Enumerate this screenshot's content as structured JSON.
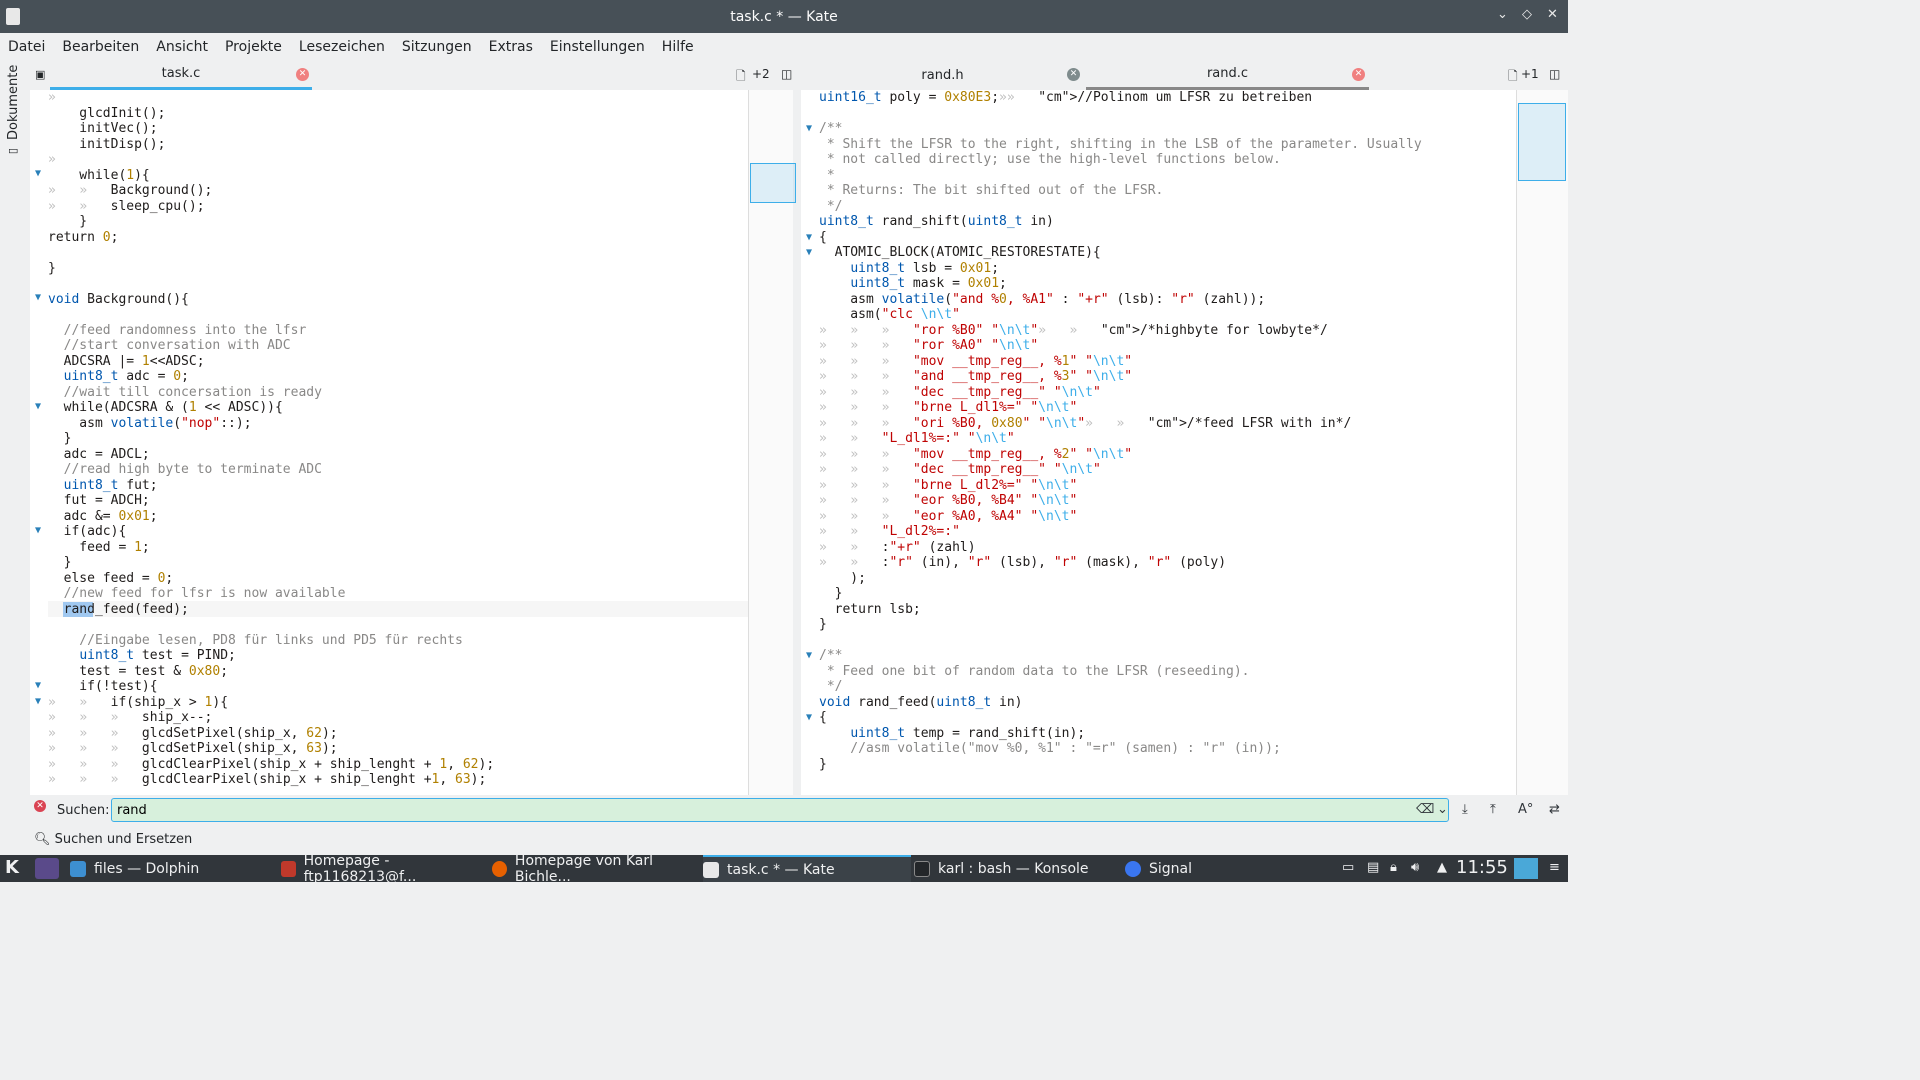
{
  "window": {
    "title": "task.c * — Kate"
  },
  "menu": [
    "Datei",
    "Bearbeiten",
    "Ansicht",
    "Projekte",
    "Lesezeichen",
    "Sitzungen",
    "Extras",
    "Einstellungen",
    "Hilfe"
  ],
  "sidebar": {
    "label": "Dokumente"
  },
  "left_pane": {
    "tab": "task.c",
    "more_tabs": "+2",
    "lines": [
      "»",
      "    glcdInit();",
      "    initVec();",
      "    initDisp();",
      "»",
      "    while(1){",
      "»   »   Background();",
      "»   »   sleep_cpu();",
      "    }",
      "return 0;",
      "",
      "}",
      "",
      "void Background(){",
      "",
      "  //feed randomness into the lfsr",
      "  //start conversation with ADC",
      "  ADCSRA |= 1<<ADSC;",
      "  uint8_t adc = 0;",
      "  //wait till concersation is ready",
      "  while(ADCSRA & (1 << ADSC)){",
      "    asm volatile(\"nop\"::);",
      "  }",
      "  adc = ADCL;",
      "  //read high byte to terminate ADC",
      "  uint8_t fut;",
      "  fut = ADCH;",
      "  adc &= 0x01;",
      "  if(adc){",
      "    feed = 1;",
      "  }",
      "  else feed = 0;",
      "  //new feed for lfsr is now available",
      "  rand_feed(feed);",
      "",
      "    //Eingabe lesen, PD8 für links und PD5 für rechts",
      "    uint8_t test = PIND;",
      "    test = test & 0x80;",
      "    if(!test){",
      "»   »   if(ship_x > 1){",
      "»   »   »   ship_x--;",
      "»   »   »   glcdSetPixel(ship_x, 62);",
      "»   »   »   glcdSetPixel(ship_x, 63);",
      "»   »   »   glcdClearPixel(ship_x + ship_lenght + 1, 62);",
      "»   »   »   glcdClearPixel(ship_x + ship_lenght +1, 63);"
    ]
  },
  "right_pane": {
    "tab1": "rand.h",
    "tab2": "rand.c",
    "more_tabs": "+1",
    "lines": [
      "uint16_t poly = 0x80E3;»»   //Polinom um LFSR zu betreiben",
      "",
      "/**",
      " * Shift the LFSR to the right, shifting in the LSB of the parameter. Usually",
      " * not called directly; use the high-level functions below.",
      " *",
      " * Returns: The bit shifted out of the LFSR.",
      " */",
      "uint8_t rand_shift(uint8_t in)",
      "{",
      "  ATOMIC_BLOCK(ATOMIC_RESTORESTATE){",
      "    uint8_t lsb = 0x01;",
      "    uint8_t mask = 0x01;",
      "    asm volatile(\"and %0, %A1\" : \"+r\" (lsb): \"r\" (zahl));",
      "    asm(\"clc \\n\\t\"",
      "»   »   »   \"ror %B0\" \"\\n\\t\"»   »   /*highbyte for lowbyte*/",
      "»   »   »   \"ror %A0\" \"\\n\\t\"",
      "»   »   »   \"mov __tmp_reg__, %1\" \"\\n\\t\"",
      "»   »   »   \"and __tmp_reg__, %3\" \"\\n\\t\"",
      "»   »   »   \"dec __tmp_reg__\" \"\\n\\t\"",
      "»   »   »   \"brne L_dl1%=\" \"\\n\\t\"",
      "»   »   »   \"ori %B0, 0x80\" \"\\n\\t\"»   »   /*feed LFSR with in*/",
      "»   »   \"L_dl1%=:\" \"\\n\\t\"",
      "»   »   »   \"mov __tmp_reg__, %2\" \"\\n\\t\"",
      "»   »   »   \"dec __tmp_reg__\" \"\\n\\t\"",
      "»   »   »   \"brne L_dl2%=\" \"\\n\\t\"",
      "»   »   »   \"eor %B0, %B4\" \"\\n\\t\"",
      "»   »   »   \"eor %A0, %A4\" \"\\n\\t\"",
      "»   »   \"L_dl2%=:\"",
      "»   »   :\"+r\" (zahl)",
      "»   »   :\"r\" (in), \"r\" (lsb), \"r\" (mask), \"r\" (poly)",
      "    );",
      "  }",
      "  return lsb;",
      "}",
      "",
      "/**",
      " * Feed one bit of random data to the LFSR (reseeding).",
      " */",
      "void rand_feed(uint8_t in)",
      "{",
      "    uint8_t temp = rand_shift(in);",
      "    //asm volatile(\"mov %0, %1\" : \"=r\" (samen) : \"r\" (in));",
      "}"
    ]
  },
  "search": {
    "label": "Suchen:",
    "value": "rand",
    "replace_label": "Suchen und Ersetzen"
  },
  "taskbar": {
    "tasks": [
      "files — Dolphin",
      "Homepage - ftp1168213@f...",
      "Homepage von Karl Bichle...",
      "task.c * — Kate",
      "karl : bash — Konsole",
      "Signal"
    ],
    "clock": "11:55"
  },
  "colors": {
    "accent": "#3daee9",
    "titlebar": "#475057",
    "taskbar": "#31363b",
    "search_bg": "#d7f0dc"
  }
}
